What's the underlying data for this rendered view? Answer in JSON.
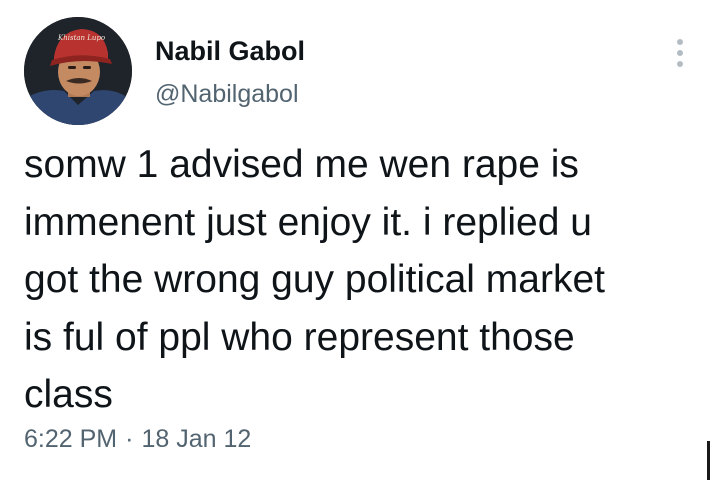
{
  "author": {
    "name": "Nabil Gabol",
    "handle": "@Nabilgabol",
    "avatar_icon": "profile-photo",
    "avatar_cap_text": "Khistan Lupo"
  },
  "tweet": {
    "lines": [
      "somw 1 advised me wen rape is",
      "immenent just enjoy it. i replied u",
      "got the wrong guy political market",
      "is ful of ppl who represent those",
      "class"
    ],
    "time": "6:22 PM",
    "separator": "·",
    "date": "18 Jan 12"
  },
  "more_menu_icon": "more-vertical-icon",
  "colors": {
    "text_primary": "#0f1419",
    "text_secondary": "#536471",
    "background": "#ffffff"
  }
}
